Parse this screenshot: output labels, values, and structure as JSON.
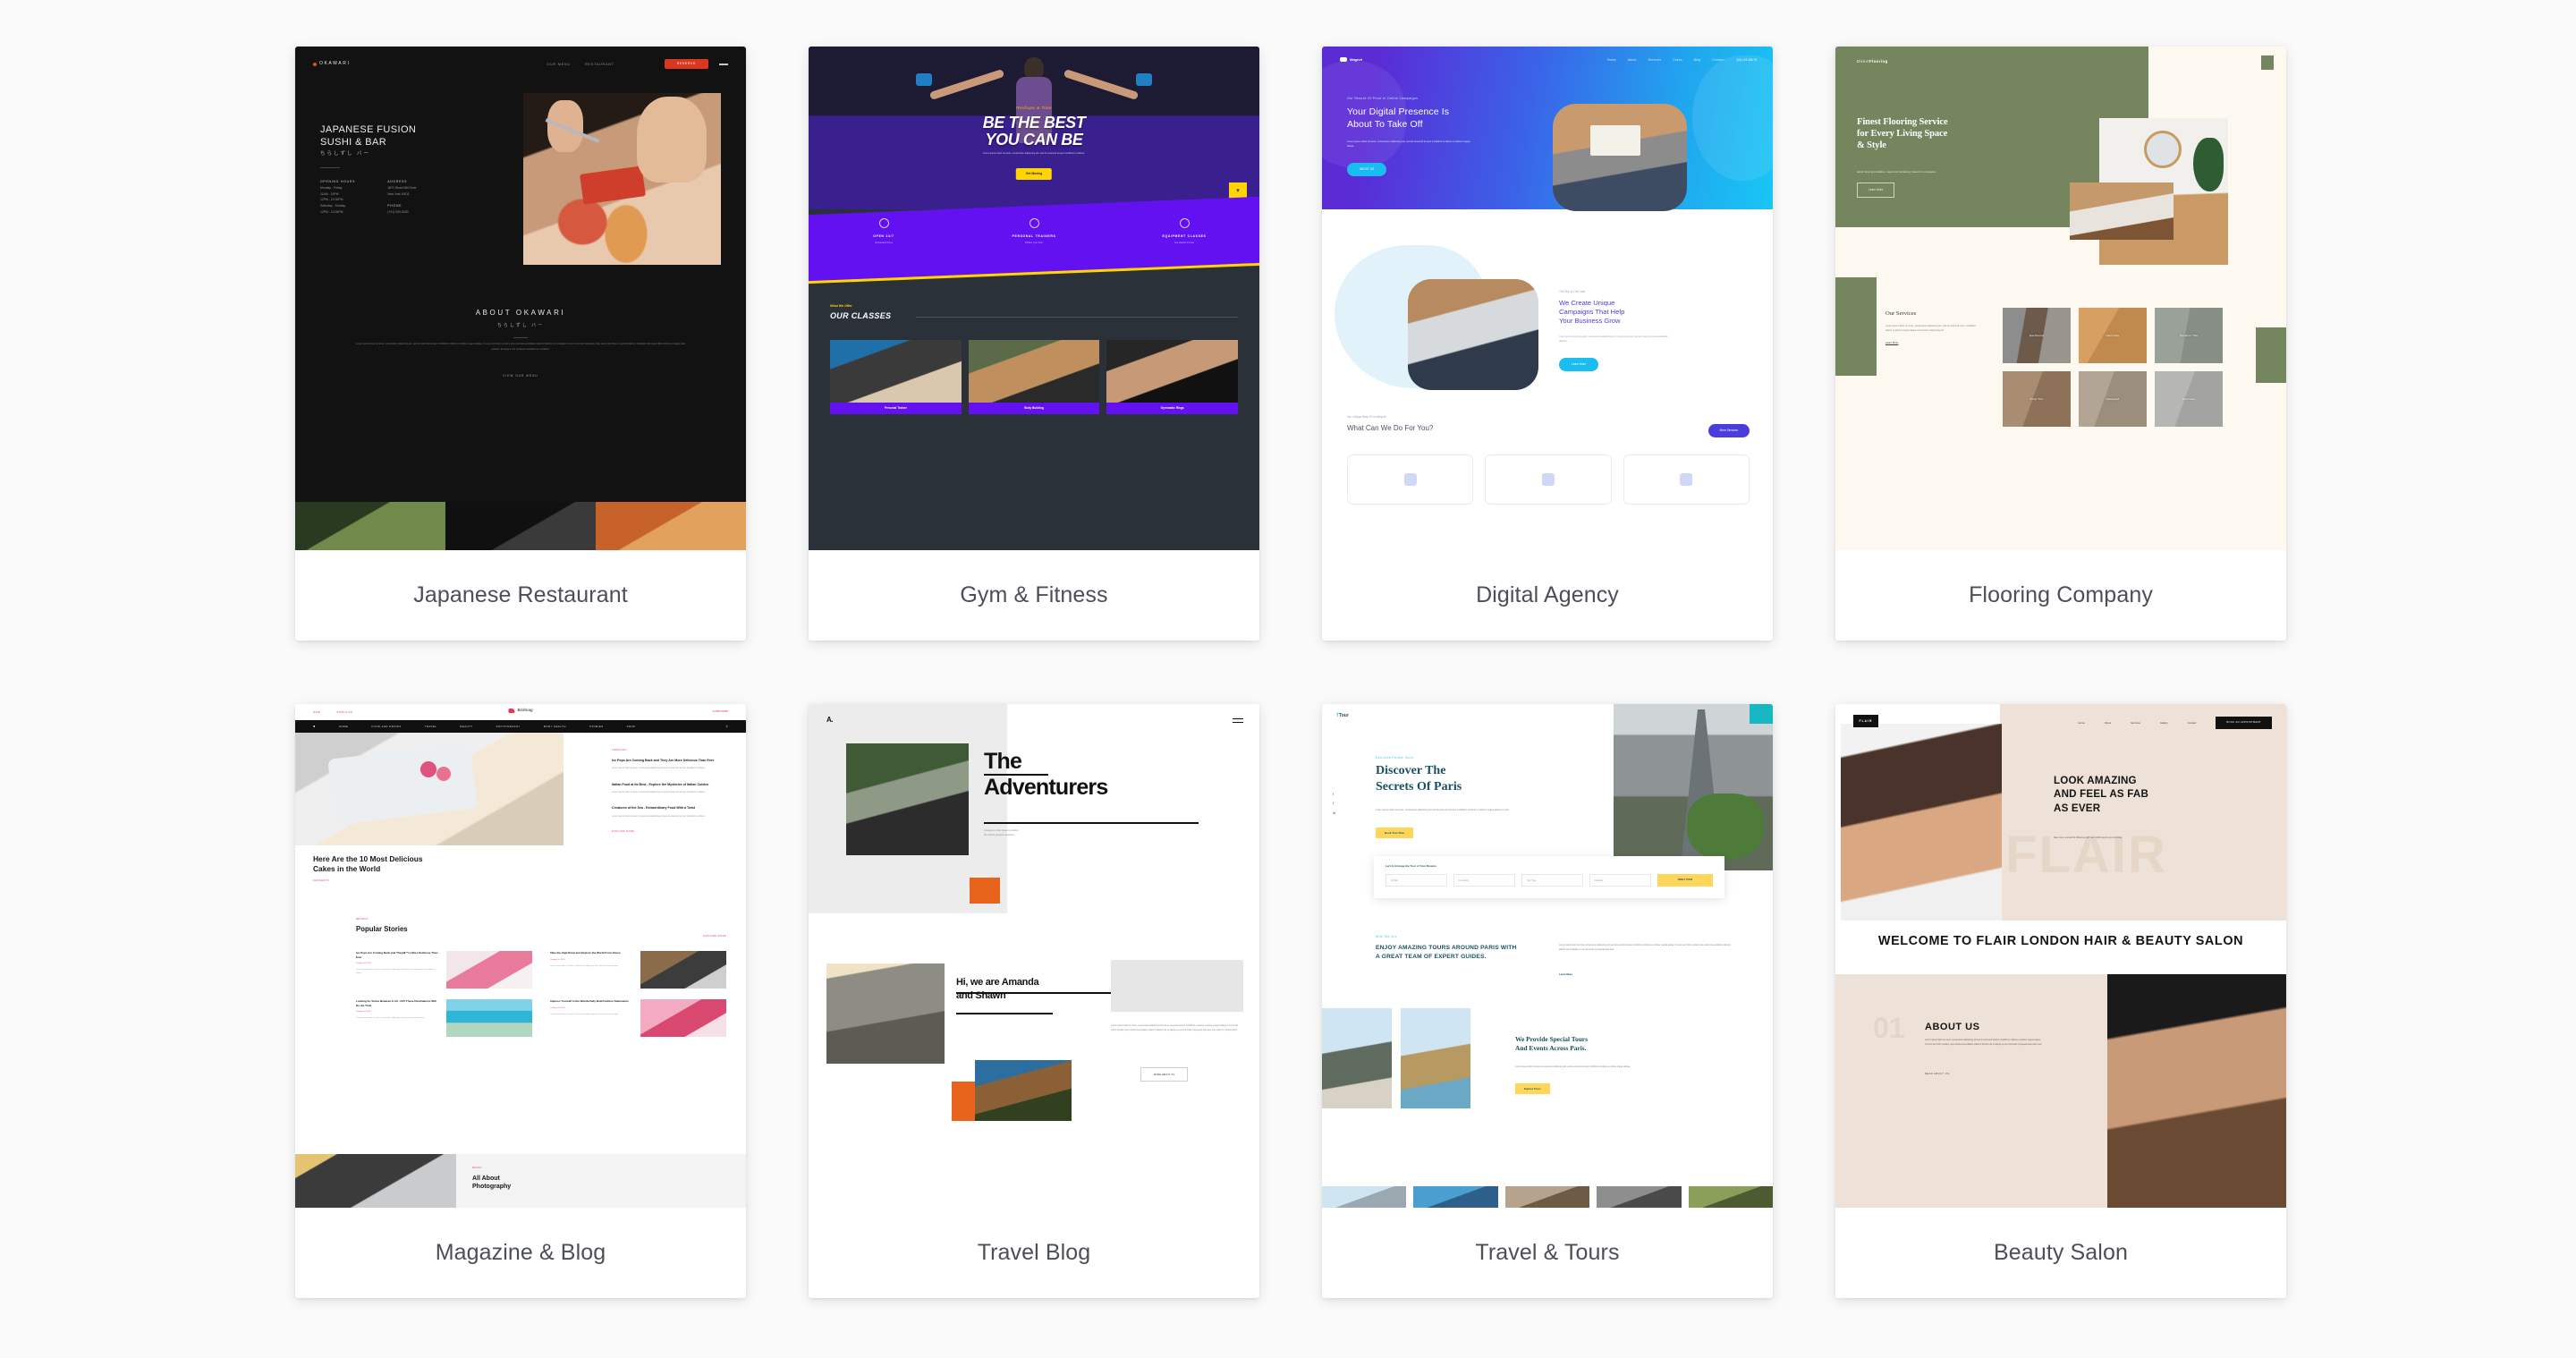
{
  "cards": [
    {
      "id": "japanese-restaurant",
      "caption": "Japanese Restaurant",
      "site": {
        "logo": "OKAWARI",
        "nav": [
          "OUR MENU",
          "RESTAURANT"
        ],
        "cta": "RESERVE",
        "headline": "JAPANESE FUSION\nSUSHI & BAR",
        "headline_jp": "ちらしずし バー",
        "info_col1_title": "OPENING HOURS",
        "info_col1": [
          "Monday - Friday",
          "11AM - 10PM",
          "12PM - 10:30PM",
          "Saturday - Sunday",
          "12PM - 10:30PM"
        ],
        "info_col2_title": "ADDRESS",
        "info_col2": [
          "1871 Wood Mill Drive",
          "New York 10011"
        ],
        "info_col3_title": "PHONE",
        "info_col3": [
          "(+01) 000-0000"
        ],
        "about_title": "ABOUT OKAWARI",
        "about_jp": "ちらしずし バー",
        "about_text": "Lorem ipsum dolor sit amet, consectetur adipiscing elit, sed do eiusmod tempor incididunt ut labore et dolore magna aliqua. Ut enim ad minim veniam, quis nostrud exercitation ullamco laboris nisi ut aliquip ex ea commodo consequat. Duis aute irure dolor in reprehenderit in voluptate velit esse cillum dolore eu fugiat nulla pariatur. Excepteur sint occaecat cupidatat non proident.",
        "about_link": "VIEW OUR MENU"
      }
    },
    {
      "id": "gym-fitness",
      "caption": "Gym & Fitness",
      "site": {
        "eyebrow": "Reshape & Tone",
        "headline": "BE THE BEST\nYOU CAN BE",
        "paragraph": "Lorem ipsum dolor sit amet, consectetur adipiscing elit, sed do eiusmod tempor incididunt ut labore.",
        "cta": "Get Moving",
        "features": [
          {
            "title": "OPEN 24/7",
            "sub": "Convenient hours",
            "icon": "clock-icon"
          },
          {
            "title": "PERSONAL TRAINERS",
            "sub": "Perfect your form",
            "icon": "trainer-icon"
          },
          {
            "title": "EQUIPMENT CLASSES",
            "sub": "Get started for free",
            "icon": "equipment-icon"
          }
        ],
        "section_kicker": "What We Offer",
        "section_title": "OUR CLASSES",
        "classes": [
          "Personal Trainer",
          "Body Building",
          "Gymnastic Rings"
        ]
      }
    },
    {
      "id": "digital-agency",
      "caption": "Digital Agency",
      "site": {
        "logo": "Magnet",
        "nav": [
          "Home",
          "About",
          "Services",
          "Cases",
          "Blog",
          "Contact"
        ],
        "phone": "(00) 123 456 78",
        "kicker": "Our Record Of Proof In Online Campaigns",
        "headline": "Your Digital Presence Is\nAbout To Take Off",
        "paragraph": "Lorem ipsum dolor sit amet, consectetur adipiscing elit, sed do eiusmod tempor incididunt ut labore et dolore magna aliqua.",
        "cta": "ABOUT US",
        "kicker2": "The Sky Is The Limit",
        "headline2": "We Create Unique\nCampaigns That Help\nYour Business Grow",
        "paragraph2": "Lorem ipsum dolor sit amet, consectetur adipiscing elit. Ut enim ad minim veniam quis nostrud exercitation ullamco.",
        "cta2": "Learn More",
        "kicker3": "Our Unique Way Of Looking At",
        "headline3": "What Can We Do For You?",
        "cta3": "More Services"
      }
    },
    {
      "id": "flooring-company",
      "caption": "Flooring Company",
      "site": {
        "logo_light": "Direct",
        "logo_bold": "Flooring",
        "headline": "Finest Flooring Service\nfor Every Living Space\n& Style",
        "paragraph": "Expert flooring installation, repair and refinishing, based in Los Angeles.",
        "cta": "Learn More",
        "services_title": "Our Services",
        "services_text": "Lorem ipsum dolor sit amet, consectetur adipiscing elit, sed do eiusmod nunc, incididunt labore ut dolore magna aliqua consectetur adipiscing elit.",
        "services_link": "Learn More",
        "tiles": [
          "Hardwood",
          "Laminate",
          "Ceramic Tile",
          "Vinyl Tile",
          "Carpeted",
          "Concrete"
        ]
      }
    },
    {
      "id": "magazine-blog",
      "caption": "Magazine & Blog",
      "site": {
        "top_links": [
          "NEW",
          "POPULAR"
        ],
        "brand": "Birdmag",
        "subscribe": "SUBSCRIBE",
        "nav": [
          "HOME",
          "FOOD AND DRINKS",
          "TRAVEL",
          "BEAUTY",
          "PHOTOGRAPHY",
          "BODY HEALTH",
          "STORIES",
          "SHOP"
        ],
        "hero_kicker": "RECIPES",
        "hero_title": "Here Are the 10 Most Delicious\nCakes in the World",
        "hero_tag": "DESSERTS",
        "sidebar_kicker": "TRENDING",
        "sidebar": [
          {
            "title": "Ice Pops Are Coming Back and They Are More Delicious Than Ever",
            "excerpt": "Lorem ipsum dolor sit amet, consectetur adipiscing elit sed do eiusmod tempor incididunt ut labore."
          },
          {
            "title": "Italian Food at Its Best - Explore the Mysteries of Italian Cuisine",
            "excerpt": "Lorem ipsum dolor sit amet, consectetur adipiscing elit sed do eiusmod tempor incididunt ut labore."
          },
          {
            "title": "Creatures of the Sea - Extraordinary Food With a Twist",
            "excerpt": "Lorem ipsum dolor sit amet, consectetur adipiscing elit sed do eiusmod tempor incididunt ut labore."
          }
        ],
        "sidebar_more": "EXPLORE MORE",
        "popular_kicker": "RECENT",
        "popular_title": "Popular Stories",
        "popular_more": "EXPLORE MORE",
        "stories": [
          {
            "title": "Ice Pops Are Coming Back and Theyâ€™re More Delicious Than Ever",
            "date": "October 14, 2021",
            "excerpt": "Lorem ipsum dolor sit amet, consectetur adipiscing elit sed do eiusmod tempor incididunt ut labore."
          },
          {
            "title": "Take the High Road and Explore the World From Above",
            "date": "October 14, 2021",
            "excerpt": "Lorem ipsum dolor sit amet, consectetur adipiscing elit sed do eiusmod tempor."
          },
          {
            "title": "Looking for Solice Between It All - 24/7 These Destinations Will Do the Trick",
            "date": "October 14, 2021",
            "excerpt": "Lorem ipsum dolor sit amet, consectetur adipiscing elit sed do eiusmod tempor."
          },
          {
            "title": "Impress Yourself in the Wonderfully Bold Fashion Statements",
            "date": "October 14, 2021",
            "excerpt": "Lorem ipsum dolor sit amet, consectetur adipiscing elit sed do eiusmod tempor."
          }
        ],
        "photo_kicker": "DETAIL",
        "photo_title": "All About\nPhotography"
      }
    },
    {
      "id": "travel-blog",
      "caption": "Travel Blog",
      "site": {
        "logo": "A.",
        "headline": "The\nAdventurers",
        "paragraph": "A couple on their quest to explore\nthe world's greatest treasures.",
        "headline2": "Hi, we are Amanda\nand Shawn",
        "paragraph2": "Lorem ipsum dolor sit amet, consectetur adipiscing elit sed do eiusmod tempor incididunt ut labore et dolore magna aliqua. Ut enim ad minim veniam quis nostrud exercitation ullamco laboris nisi ut aliquip ex ea commodo consequat duis aute irure dolor in reprehenderit.",
        "cta": "MORE ABOUT US"
      }
    },
    {
      "id": "travel-tours",
      "caption": "Travel & Tours",
      "site": {
        "logo": "Tour",
        "kicker": "Exclusive Private Tours",
        "headline": "Discover The\nSecrets Of Paris",
        "paragraph": "Lorem ipsum dolor sit amet, consectetur adipiscing elit sed do eiusmod tempor incididunt ut labore et dolore magna aliqua ut enim.",
        "cta": "Book Tour Now",
        "form_title": "Let Us Arrange the Tour of Your Dreams",
        "form_fields": [
          "In Paris",
          "For Adults",
          "Tour Type",
          "Duration"
        ],
        "form_submit": "FIND A TOUR",
        "kicker2": "Who We Are",
        "headline2": "ENJOY AMAZING TOURS AROUND PARIS WITH A GREAT TEAM OF EXPERT GUIDES.",
        "paragraph2": "Lorem ipsum dolor sit amet consectetur adipiscing elit sed do eiusmod tempor incididunt ut labore et dolore magna aliqua. Ut enim ad minim veniam quis nostrud exercitation ullamco laboris nisi ut aliquip ex ea commodo consequat duis aute.",
        "link2": "Learn More",
        "headline3": "We Provide Special Tours\nAnd Events Across Paris.",
        "paragraph3": "Lorem ipsum dolor sit amet consectetur adipiscing elit sed do eiusmod tempor incididunt ut labore et dolore magna aliqua.",
        "cta3": "Explore Tours"
      }
    },
    {
      "id": "beauty-salon",
      "caption": "Beauty Salon",
      "site": {
        "logo": "FLAIR",
        "nav": [
          "Home",
          "About",
          "Services",
          "Gallery",
          "Contact"
        ],
        "cta": "BOOK AN APPOINTMENT",
        "watermark": "FLAIR",
        "headline": "LOOK AMAZING\nAND FEEL AS FAB\nAS EVER",
        "paragraph": "Flair has a wonderful following with over 1000 clients and counting.",
        "welcome": "WELCOME TO FLAIR LONDON HAIR & BEAUTY SALON",
        "section_number": "01",
        "section_title": "ABOUT US",
        "section_text": "Lorem ipsum dolor sit amet, consectetur adipiscing elit sed do eiusmod tempor incididunt ut labore et dolore magna aliqua. Ut enim ad minim veniam, quis nostrud exercitation ullamco laboris nisi ut aliquip ex ea commodo consequat duis aute irure.",
        "section_link": "READ ABOUT US"
      }
    }
  ],
  "colors": {
    "page_background": "#fafafa",
    "card_background": "#ffffff",
    "caption_text": "#4c4f55",
    "japanese_accent": "#d9381e",
    "gym_purple": "#6311f0",
    "gym_yellow": "#ffd400",
    "agency_blue": "#19bdf2",
    "agency_indigo": "#4a3ddb",
    "flooring_green": "#75865f",
    "magazine_pink": "#e8385a",
    "travel_orange": "#e8641c",
    "tours_teal": "#3fc8d6",
    "tours_yellow": "#ffd65a",
    "beauty_beige": "#eee2d8"
  }
}
